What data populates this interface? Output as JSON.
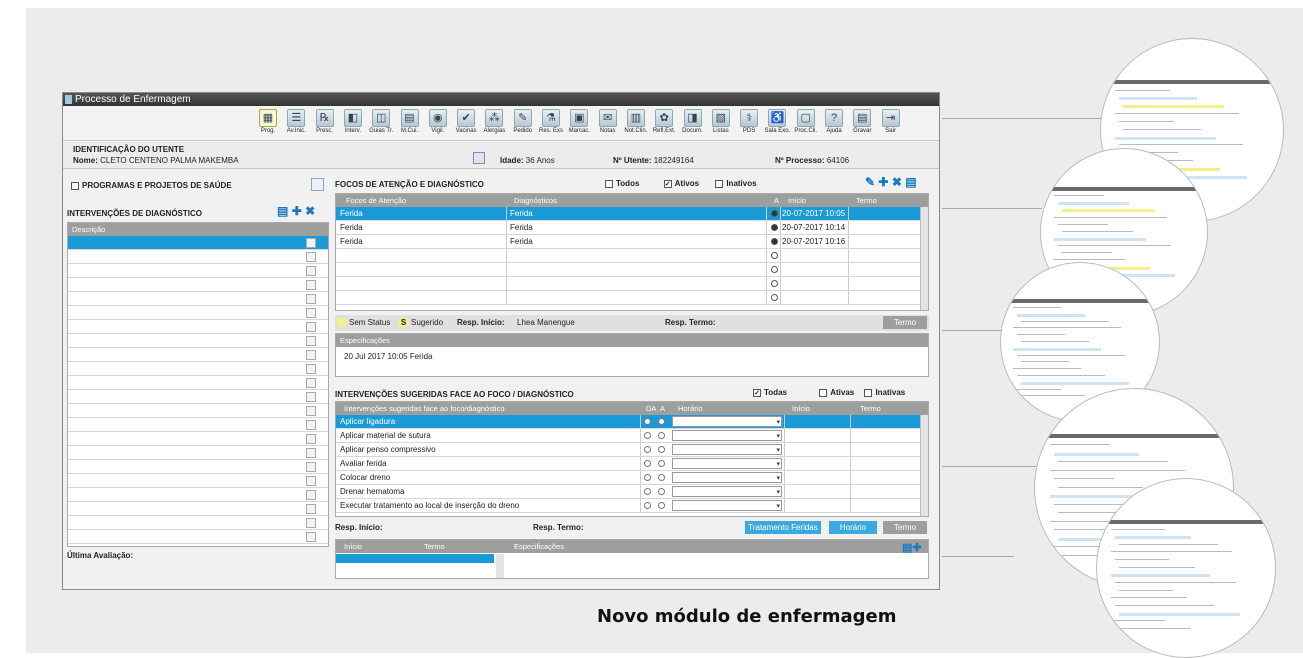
{
  "window": {
    "title": "Processo de Enfermagem"
  },
  "toolbar": [
    {
      "label": "Prog.",
      "icon": "program-icon"
    },
    {
      "label": "Av.Inic.",
      "icon": "list-icon"
    },
    {
      "label": "Presc.",
      "icon": "prescription-icon"
    },
    {
      "label": "Interv.",
      "icon": "intervention-icon"
    },
    {
      "label": "Guias Tr.",
      "icon": "guide-icon"
    },
    {
      "label": "M.Cui.",
      "icon": "care-icon"
    },
    {
      "label": "Vigil.",
      "icon": "eye-icon"
    },
    {
      "label": "Vacinas",
      "icon": "vaccine-icon"
    },
    {
      "label": "Alergias",
      "icon": "allergy-icon"
    },
    {
      "label": "Pedido",
      "icon": "request-icon"
    },
    {
      "label": "Res. Exs",
      "icon": "results-icon"
    },
    {
      "label": "Marcac.",
      "icon": "calendar-icon"
    },
    {
      "label": "Notas",
      "icon": "notes-icon"
    },
    {
      "label": "Not.Clin.",
      "icon": "clinical-notes-icon"
    },
    {
      "label": "Refl.Ext.",
      "icon": "reflex-icon"
    },
    {
      "label": "Docum.",
      "icon": "document-icon"
    },
    {
      "label": "Listas",
      "icon": "lists-icon"
    },
    {
      "label": "PDS",
      "icon": "pds-icon"
    },
    {
      "label": "Sala Exo.",
      "icon": "room-icon"
    },
    {
      "label": "Proc.Cli.",
      "icon": "process-icon"
    },
    {
      "label": "Ajuda",
      "icon": "help-icon"
    },
    {
      "label": "Gravar",
      "icon": "save-icon"
    },
    {
      "label": "Sair",
      "icon": "exit-icon"
    }
  ],
  "patient": {
    "section": "IDENTIFICAÇÃO DO UTENTE",
    "name_label": "Nome:",
    "name": "CLETO CENTENO PALMA MAKEMBA",
    "age_label": "Idade:",
    "age": "36 Anos",
    "utente_label": "Nº Utente:",
    "utente": "182249164",
    "process_label": "Nº Processo:",
    "process": "64106"
  },
  "left": {
    "programs": "PROGRAMAS E PROJETOS DE SAÚDE",
    "interventions_title": "INTERVENÇÕES DE DIAGNÓSTICO",
    "col_desc": "Descrição",
    "last_eval": "Última Avaliação:"
  },
  "focos": {
    "title": "FOCOS DE ATENÇÃO E DIAGNÓSTICO",
    "filters": [
      "Todos",
      "Ativos",
      "Inativos"
    ],
    "columns": [
      "Focos de Atenção",
      "Diagnósticos",
      "A",
      "Início",
      "Termo"
    ],
    "rows": [
      {
        "foco": "Ferida",
        "diag": "Ferida",
        "inicio": "20-07-2017 10:05"
      },
      {
        "foco": "Ferida",
        "diag": "Ferida",
        "inicio": "20-07-2017 10:14"
      },
      {
        "foco": "Ferida",
        "diag": "Ferida",
        "inicio": "20-07-2017 10:16"
      }
    ],
    "legend_none": "Sem Status",
    "legend_s": "S",
    "legend_sug": "Sugerido",
    "resp_inicio_label": "Resp. Início:",
    "resp_inicio": "Lhea Manengue",
    "resp_termo_label": "Resp. Termo:",
    "termo_btn": "Termo",
    "spec_header": "Especificações",
    "spec_text": "20 Jul 2017 10:05  Ferida"
  },
  "sug": {
    "title": "INTERVENÇÕES SUGERIDAS FACE AO FOCO / DIAGNÓSTICO",
    "filters": [
      "Todas",
      "Ativas",
      "Inativas"
    ],
    "columns": [
      "Intervenções sugeridas face ao foco/diagnóstico",
      "DA",
      "A",
      "Horário",
      "Início",
      "Termo"
    ],
    "rows": [
      "Aplicar ligadura",
      "Aplicar material de sutura",
      "Aplicar penso compressivo",
      "Avaliar ferida",
      "Colocar dreno",
      "Drenar hematoma",
      "Executar tratamento ao local de inserção do dreno"
    ],
    "resp_inicio_label": "Resp. Início:",
    "resp_termo_label": "Resp. Termo:",
    "btn_tratamento": "Tratamento Feridas",
    "btn_horario": "Horário",
    "btn_termo": "Termo"
  },
  "bottom": {
    "columns": [
      "Início",
      "Termo",
      "Especificações"
    ]
  },
  "caption": "Novo módulo de enfermagem",
  "colors": {
    "accent": "#1a9ad6",
    "header": "#9e9e9e",
    "titlebar": "#333333",
    "yellow": "#f3ef8a"
  }
}
